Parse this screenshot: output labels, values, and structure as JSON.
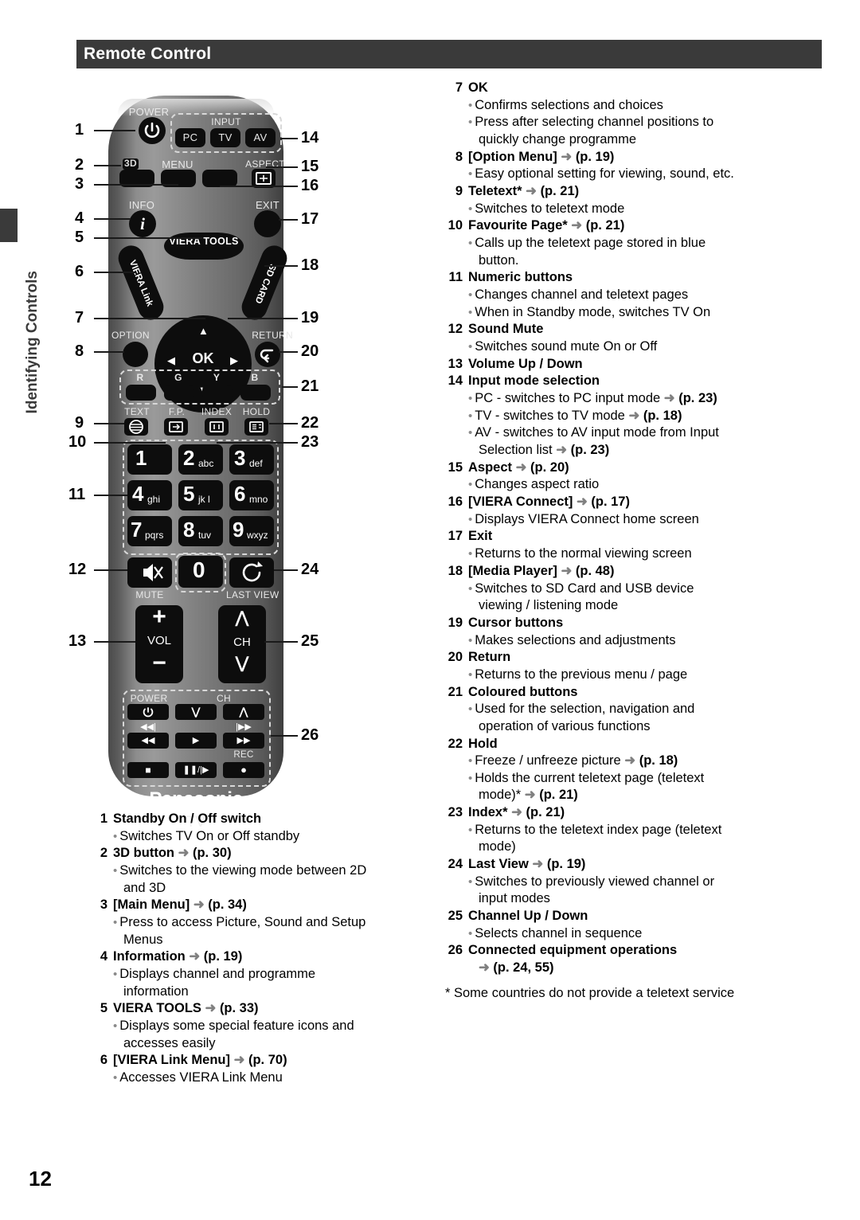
{
  "header": {
    "title": "Remote Control"
  },
  "side_tab": {
    "label": "Identifying Controls"
  },
  "page": {
    "number": "12"
  },
  "remote": {
    "brand": "Panasonic",
    "device": "TV",
    "labels": {
      "power": "POWER",
      "input": "INPUT",
      "pc": "PC",
      "tv": "TV",
      "av": "AV",
      "menu": "MENU",
      "aspect": "ASPECT",
      "info": "INFO",
      "exit": "EXIT",
      "viera_tools": "VIERA TOOLS",
      "viera_link": "VIERA Link",
      "sd_card": "SD CARD",
      "ok": "OK",
      "option": "OPTION",
      "return": "RETURN",
      "colour_r": "R",
      "colour_g": "G",
      "colour_y": "Y",
      "colour_b": "B",
      "text": "TEXT",
      "fp": "F.P.",
      "index": "INDEX",
      "hold": "HOLD",
      "mute": "MUTE",
      "last_view": "LAST VIEW",
      "vol": "VOL",
      "ch": "CH",
      "deck_power": "POWER",
      "deck_ch": "CH",
      "rec": "REC"
    },
    "keypad": [
      {
        "digit": "1",
        "letters": ""
      },
      {
        "digit": "2",
        "letters": "abc"
      },
      {
        "digit": "3",
        "letters": "def"
      },
      {
        "digit": "4",
        "letters": "ghi"
      },
      {
        "digit": "5",
        "letters": "jk l"
      },
      {
        "digit": "6",
        "letters": "mno"
      },
      {
        "digit": "7",
        "letters": "pqrs"
      },
      {
        "digit": "8",
        "letters": "tuv"
      },
      {
        "digit": "9",
        "letters": "wxyz"
      },
      {
        "digit": "0",
        "letters": ""
      }
    ],
    "callouts_left": [
      "1",
      "2",
      "3",
      "4",
      "5",
      "6",
      "7",
      "8",
      "9",
      "10",
      "11",
      "12",
      "13"
    ],
    "callouts_right": [
      "14",
      "15",
      "16",
      "17",
      "18",
      "19",
      "20",
      "21",
      "22",
      "23",
      "24",
      "25",
      "26"
    ]
  },
  "entries_left": [
    {
      "num": "1",
      "title": "Standby On / Off switch",
      "lines": [
        {
          "type": "bullet",
          "text": "Switches TV On or Off standby"
        }
      ]
    },
    {
      "num": "2",
      "title": "3D button",
      "arrow": true,
      "page_ref": "(p. 30)",
      "lines": [
        {
          "type": "bullet",
          "text": "Switches to the viewing mode between 2D"
        },
        {
          "type": "cont",
          "text": "and 3D"
        }
      ]
    },
    {
      "num": "3",
      "title": "[Main Menu]",
      "arrow": true,
      "page_ref": "(p. 34)",
      "lines": [
        {
          "type": "bullet",
          "text": "Press to access Picture, Sound and Setup"
        },
        {
          "type": "cont",
          "text": "Menus"
        }
      ]
    },
    {
      "num": "4",
      "title": "Information",
      "arrow": true,
      "page_ref": "(p. 19)",
      "lines": [
        {
          "type": "bullet",
          "text": "Displays channel and programme"
        },
        {
          "type": "cont",
          "text": "information"
        }
      ]
    },
    {
      "num": "5",
      "title": "VIERA TOOLS",
      "arrow": true,
      "page_ref": "(p. 33)",
      "lines": [
        {
          "type": "bullet",
          "text": "Displays some special feature icons and"
        },
        {
          "type": "cont",
          "text": "accesses easily"
        }
      ]
    },
    {
      "num": "6",
      "title": "[VIERA Link Menu]",
      "arrow": true,
      "page_ref": "(p. 70)",
      "lines": [
        {
          "type": "bullet",
          "text": "Accesses VIERA Link Menu"
        }
      ]
    }
  ],
  "entries_right": [
    {
      "num": "7",
      "title": "OK",
      "lines": [
        {
          "type": "bullet",
          "text": "Confirms selections and choices"
        },
        {
          "type": "bullet",
          "text": "Press after selecting channel positions to"
        },
        {
          "type": "cont",
          "text": "quickly change programme"
        }
      ]
    },
    {
      "num": "8",
      "title": "[Option Menu]",
      "arrow": true,
      "page_ref": "(p. 19)",
      "lines": [
        {
          "type": "bullet",
          "text": "Easy optional setting for viewing, sound, etc."
        }
      ]
    },
    {
      "num": "9",
      "title": "Teletext*",
      "arrow": true,
      "page_ref": "(p. 21)",
      "lines": [
        {
          "type": "bullet",
          "text": "Switches to teletext mode"
        }
      ]
    },
    {
      "num": "10",
      "title": "Favourite Page*",
      "arrow": true,
      "page_ref": "(p. 21)",
      "lines": [
        {
          "type": "bullet",
          "text": "Calls up the teletext page stored in blue"
        },
        {
          "type": "cont",
          "text": "button."
        }
      ]
    },
    {
      "num": "11",
      "title": "Numeric buttons",
      "lines": [
        {
          "type": "bullet",
          "text": "Changes channel and teletext pages"
        },
        {
          "type": "bullet",
          "text": "When in Standby mode, switches TV On"
        }
      ]
    },
    {
      "num": "12",
      "title": "Sound Mute",
      "lines": [
        {
          "type": "bullet",
          "text": "Switches sound mute On or Off"
        }
      ]
    },
    {
      "num": "13",
      "title": "Volume Up / Down",
      "lines": []
    },
    {
      "num": "14",
      "title": "Input mode selection",
      "lines": [
        {
          "type": "bullet",
          "text": "PC - switches to PC input mode",
          "arrow": true,
          "page_ref": "(p. 23)"
        },
        {
          "type": "bullet",
          "text": "TV - switches to TV mode",
          "arrow": true,
          "page_ref": "(p. 18)"
        },
        {
          "type": "bullet",
          "text": "AV - switches to AV input mode from Input"
        },
        {
          "type": "cont",
          "text": "Selection list",
          "arrow": true,
          "page_ref": "(p. 23)"
        }
      ]
    },
    {
      "num": "15",
      "title": "Aspect",
      "arrow": true,
      "page_ref": "(p. 20)",
      "lines": [
        {
          "type": "bullet",
          "text": "Changes aspect ratio"
        }
      ]
    },
    {
      "num": "16",
      "title": "[VIERA Connect]",
      "arrow": true,
      "page_ref": "(p. 17)",
      "lines": [
        {
          "type": "bullet",
          "text": "Displays VIERA Connect home screen"
        }
      ]
    },
    {
      "num": "17",
      "title": "Exit",
      "lines": [
        {
          "type": "bullet",
          "text": "Returns to the normal viewing screen"
        }
      ]
    },
    {
      "num": "18",
      "title": "[Media Player]",
      "arrow": true,
      "page_ref": "(p. 48)",
      "lines": [
        {
          "type": "bullet",
          "text": "Switches to SD Card and USB device"
        },
        {
          "type": "cont",
          "text": "viewing / listening mode"
        }
      ]
    },
    {
      "num": "19",
      "title": "Cursor buttons",
      "lines": [
        {
          "type": "bullet",
          "text": "Makes selections and adjustments"
        }
      ]
    },
    {
      "num": "20",
      "title": "Return",
      "lines": [
        {
          "type": "bullet",
          "text": "Returns to the previous menu / page"
        }
      ]
    },
    {
      "num": "21",
      "title": "Coloured buttons",
      "lines": [
        {
          "type": "bullet",
          "text": "Used for the selection, navigation and"
        },
        {
          "type": "cont",
          "text": "operation of various functions"
        }
      ]
    },
    {
      "num": "22",
      "title": "Hold",
      "lines": [
        {
          "type": "bullet",
          "text": "Freeze / unfreeze picture",
          "arrow": true,
          "page_ref": "(p. 18)"
        },
        {
          "type": "bullet",
          "text": "Holds the current teletext page (teletext"
        },
        {
          "type": "cont",
          "text": "mode)*",
          "arrow": true,
          "page_ref": "(p. 21)"
        }
      ]
    },
    {
      "num": "23",
      "title": "Index*",
      "arrow": true,
      "page_ref": "(p. 21)",
      "lines": [
        {
          "type": "bullet",
          "text": "Returns to the teletext index page (teletext"
        },
        {
          "type": "cont",
          "text": "mode)"
        }
      ]
    },
    {
      "num": "24",
      "title": "Last View",
      "arrow": true,
      "page_ref": "(p. 19)",
      "lines": [
        {
          "type": "bullet",
          "text": "Switches to previously viewed channel or"
        },
        {
          "type": "cont",
          "text": "input modes"
        }
      ]
    },
    {
      "num": "25",
      "title": "Channel Up / Down",
      "lines": [
        {
          "type": "bullet",
          "text": "Selects channel in sequence"
        }
      ]
    },
    {
      "num": "26",
      "title": "Connected equipment operations",
      "lines": [
        {
          "type": "cont",
          "text": "",
          "arrow": true,
          "page_ref": "(p. 24, 55)"
        }
      ]
    }
  ],
  "footnote": "* Some countries do not provide a teletext service"
}
